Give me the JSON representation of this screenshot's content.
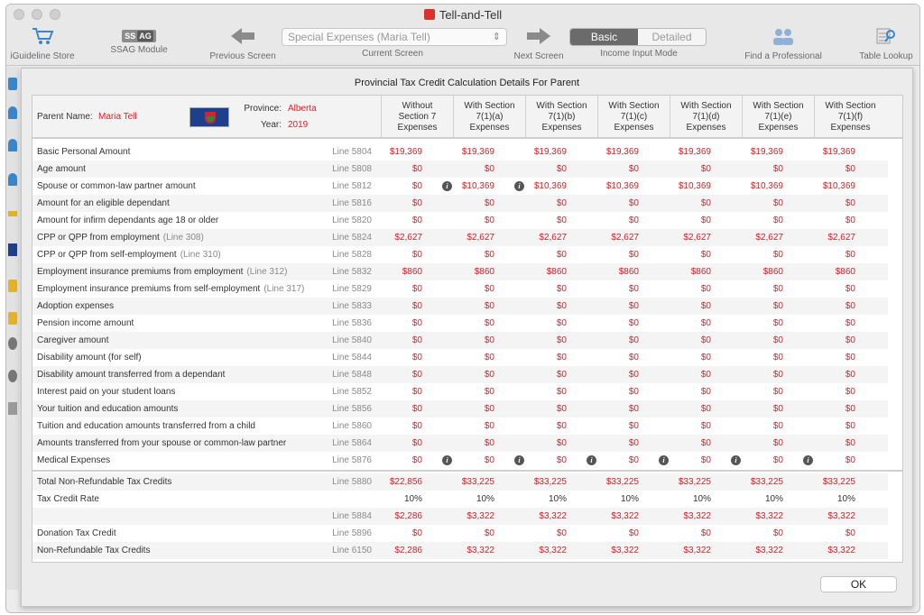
{
  "window": {
    "title": "Tell-and-Tell"
  },
  "toolbar": {
    "store_label": "iGuideline Store",
    "ssag_label": "SSAG Module",
    "ssag_badge_a": "SS",
    "ssag_badge_b": "AG",
    "prev_label": "Previous Screen",
    "current_screen_value": "Special Expenses (Maria Tell)",
    "current_label": "Current Screen",
    "next_label": "Next Screen",
    "mode_basic": "Basic",
    "mode_detailed": "Detailed",
    "mode_label": "Income Input Mode",
    "professional_label": "Find a Professional",
    "lookup_label": "Table Lookup"
  },
  "sheet": {
    "title": "Provincial Tax Credit Calculation Details For Parent",
    "parent_name_label": "Parent Name:",
    "parent_name": "Maria Tell",
    "province_label": "Province:",
    "province": "Alberta",
    "year_label": "Year:",
    "year": "2019",
    "columns": [
      [
        "Without",
        "Section 7",
        "Expenses"
      ],
      [
        "With Section",
        "7(1)(a)",
        "Expenses"
      ],
      [
        "With Section",
        "7(1)(b)",
        "Expenses"
      ],
      [
        "With Section",
        "7(1)(c)",
        "Expenses"
      ],
      [
        "With Section",
        "7(1)(d)",
        "Expenses"
      ],
      [
        "With Section",
        "7(1)(e)",
        "Expenses"
      ],
      [
        "With Section",
        "7(1)(f)",
        "Expenses"
      ]
    ],
    "rows": [
      {
        "desc": "Basic Personal Amount",
        "ref": "",
        "line": "Line 5804",
        "values": [
          "$19,369",
          "$19,369",
          "$19,369",
          "$19,369",
          "$19,369",
          "$19,369",
          "$19,369"
        ]
      },
      {
        "desc": "Age amount",
        "ref": "",
        "line": "Line 5808",
        "values": [
          "$0",
          "$0",
          "$0",
          "$0",
          "$0",
          "$0",
          "$0"
        ]
      },
      {
        "desc": "Spouse or common-law partner amount",
        "ref": "",
        "line": "Line 5812",
        "values": [
          "$0",
          "$10,369",
          "$10,369",
          "$10,369",
          "$10,369",
          "$10,369",
          "$10,369"
        ],
        "info": [
          0,
          1
        ]
      },
      {
        "desc": "Amount for an eligible dependant",
        "ref": "",
        "line": "Line 5816",
        "values": [
          "$0",
          "$0",
          "$0",
          "$0",
          "$0",
          "$0",
          "$0"
        ]
      },
      {
        "desc": "Amount for infirm dependants age 18 or older",
        "ref": "",
        "line": "Line 5820",
        "values": [
          "$0",
          "$0",
          "$0",
          "$0",
          "$0",
          "$0",
          "$0"
        ]
      },
      {
        "desc": "CPP or QPP from employment",
        "ref": "(Line 308)",
        "line": "Line 5824",
        "values": [
          "$2,627",
          "$2,627",
          "$2,627",
          "$2,627",
          "$2,627",
          "$2,627",
          "$2,627"
        ]
      },
      {
        "desc": "CPP or QPP from self-employment",
        "ref": "(Line 310)",
        "line": "Line 5828",
        "values": [
          "$0",
          "$0",
          "$0",
          "$0",
          "$0",
          "$0",
          "$0"
        ]
      },
      {
        "desc": "Employment insurance premiums from employment",
        "ref": "(Line 312)",
        "line": "Line 5832",
        "values": [
          "$860",
          "$860",
          "$860",
          "$860",
          "$860",
          "$860",
          "$860"
        ]
      },
      {
        "desc": "Employment insurance premiums from self-employment",
        "ref": "(Line 317)",
        "line": "Line 5829",
        "values": [
          "$0",
          "$0",
          "$0",
          "$0",
          "$0",
          "$0",
          "$0"
        ]
      },
      {
        "desc": "Adoption expenses",
        "ref": "",
        "line": "Line 5833",
        "values": [
          "$0",
          "$0",
          "$0",
          "$0",
          "$0",
          "$0",
          "$0"
        ]
      },
      {
        "desc": "Pension income amount",
        "ref": "",
        "line": "Line 5836",
        "values": [
          "$0",
          "$0",
          "$0",
          "$0",
          "$0",
          "$0",
          "$0"
        ]
      },
      {
        "desc": "Caregiver amount",
        "ref": "",
        "line": "Line 5840",
        "values": [
          "$0",
          "$0",
          "$0",
          "$0",
          "$0",
          "$0",
          "$0"
        ]
      },
      {
        "desc": "Disability amount (for self)",
        "ref": "",
        "line": "Line 5844",
        "values": [
          "$0",
          "$0",
          "$0",
          "$0",
          "$0",
          "$0",
          "$0"
        ]
      },
      {
        "desc": "Disability amount transferred from a dependant",
        "ref": "",
        "line": "Line 5848",
        "values": [
          "$0",
          "$0",
          "$0",
          "$0",
          "$0",
          "$0",
          "$0"
        ]
      },
      {
        "desc": "Interest paid on your student loans",
        "ref": "",
        "line": "Line 5852",
        "values": [
          "$0",
          "$0",
          "$0",
          "$0",
          "$0",
          "$0",
          "$0"
        ]
      },
      {
        "desc": "Your tuition and education amounts",
        "ref": "",
        "line": "Line 5856",
        "values": [
          "$0",
          "$0",
          "$0",
          "$0",
          "$0",
          "$0",
          "$0"
        ]
      },
      {
        "desc": "Tuition and education amounts transferred from a child",
        "ref": "",
        "line": "Line 5860",
        "values": [
          "$0",
          "$0",
          "$0",
          "$0",
          "$0",
          "$0",
          "$0"
        ]
      },
      {
        "desc": "Amounts transferred from your spouse or common-law partner",
        "ref": "",
        "line": "Line 5864",
        "values": [
          "$0",
          "$0",
          "$0",
          "$0",
          "$0",
          "$0",
          "$0"
        ]
      },
      {
        "desc": "Medical Expenses",
        "ref": "",
        "line": "Line 5876",
        "values": [
          "$0",
          "$0",
          "$0",
          "$0",
          "$0",
          "$0",
          "$0"
        ],
        "info": [
          0,
          1,
          2,
          3,
          4,
          5
        ]
      }
    ],
    "totals": [
      {
        "desc": "Total Non-Refundable Tax Credits",
        "line": "Line 5880",
        "values": [
          "$22,856",
          "$33,225",
          "$33,225",
          "$33,225",
          "$33,225",
          "$33,225",
          "$33,225"
        ]
      },
      {
        "desc": "Tax Credit Rate",
        "line": "",
        "values": [
          "10%",
          "10%",
          "10%",
          "10%",
          "10%",
          "10%",
          "10%"
        ],
        "plain": true
      },
      {
        "desc": "",
        "line": "Line 5884",
        "values": [
          "$2,286",
          "$3,322",
          "$3,322",
          "$3,322",
          "$3,322",
          "$3,322",
          "$3,322"
        ]
      },
      {
        "desc": "Donation Tax Credit",
        "line": "Line 5896",
        "values": [
          "$0",
          "$0",
          "$0",
          "$0",
          "$0",
          "$0",
          "$0"
        ]
      },
      {
        "desc": "Non-Refundable Tax Credits",
        "line": "Line 6150",
        "values": [
          "$2,286",
          "$3,322",
          "$3,322",
          "$3,322",
          "$3,322",
          "$3,322",
          "$3,322"
        ]
      }
    ],
    "ok_label": "OK",
    "info_glyph": "i"
  },
  "colors": {
    "accent_red": "#d6222a",
    "toggle_on": "#6b6b6b"
  }
}
